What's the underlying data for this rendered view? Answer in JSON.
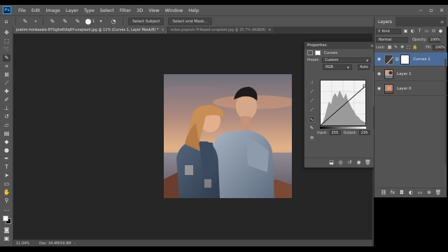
{
  "app": {
    "logo_text": "Ps"
  },
  "menu": [
    "File",
    "Edit",
    "Image",
    "Layer",
    "Type",
    "Select",
    "Filter",
    "3D",
    "View",
    "Window",
    "Help"
  ],
  "options_bar": {
    "brush_size": "1",
    "select_subject_label": "Select Subject",
    "select_mask_label": "Select and Mask..."
  },
  "tabs": [
    {
      "label": "joakim-honkasalo-87Gg5e6Ulq6Y-unsplash.jpg @ 11% (Curves 1, Layer Mask/8) *",
      "active": true
    },
    {
      "label": "milan-popovic-Fr9epsd-unsplash.jpg @ 25.7% (RGB/8)",
      "active": false
    }
  ],
  "status_bar": {
    "zoom": "11.04%",
    "doc_info": "Doc: 34.4M/59.9M"
  },
  "properties": {
    "panel_title": "Properties",
    "adjustment_name": "Curves",
    "preset_label": "Preset:",
    "preset_value": "Custom",
    "channel_value": "RGB",
    "auto_label": "Auto",
    "input_label": "Input:",
    "input_value": "255",
    "output_label": "Output:",
    "output_value": "235"
  },
  "layers": {
    "tab_label": "Layers",
    "filter_kind": "Kind",
    "blend_mode": "Normal",
    "opacity_label": "Opacity:",
    "opacity_value": "100%",
    "lock_label": "Lock:",
    "fill_label": "Fill:",
    "fill_value": "100%",
    "items": [
      {
        "name": "Curves 1",
        "selected": true
      },
      {
        "name": "Layer 1",
        "selected": false
      },
      {
        "name": "Layer 0",
        "selected": false
      }
    ]
  },
  "colors": {
    "ui_dark": "#535353",
    "canvas_bg": "#262626",
    "selection_blue": "#4b6c96",
    "ps_blue": "#31a8ff"
  },
  "icons": {
    "toolbar": [
      "move-icon",
      "marquee-icon",
      "lasso-icon",
      "quick-select-icon",
      "crop-icon",
      "frame-icon",
      "eyedropper-icon",
      "healing-icon",
      "brush-icon",
      "stamp-icon",
      "history-brush-icon",
      "eraser-icon",
      "gradient-icon",
      "blur-icon",
      "dodge-icon",
      "pen-icon",
      "type-icon",
      "path-select-icon",
      "rectangle-icon",
      "hand-icon",
      "zoom-icon"
    ]
  }
}
